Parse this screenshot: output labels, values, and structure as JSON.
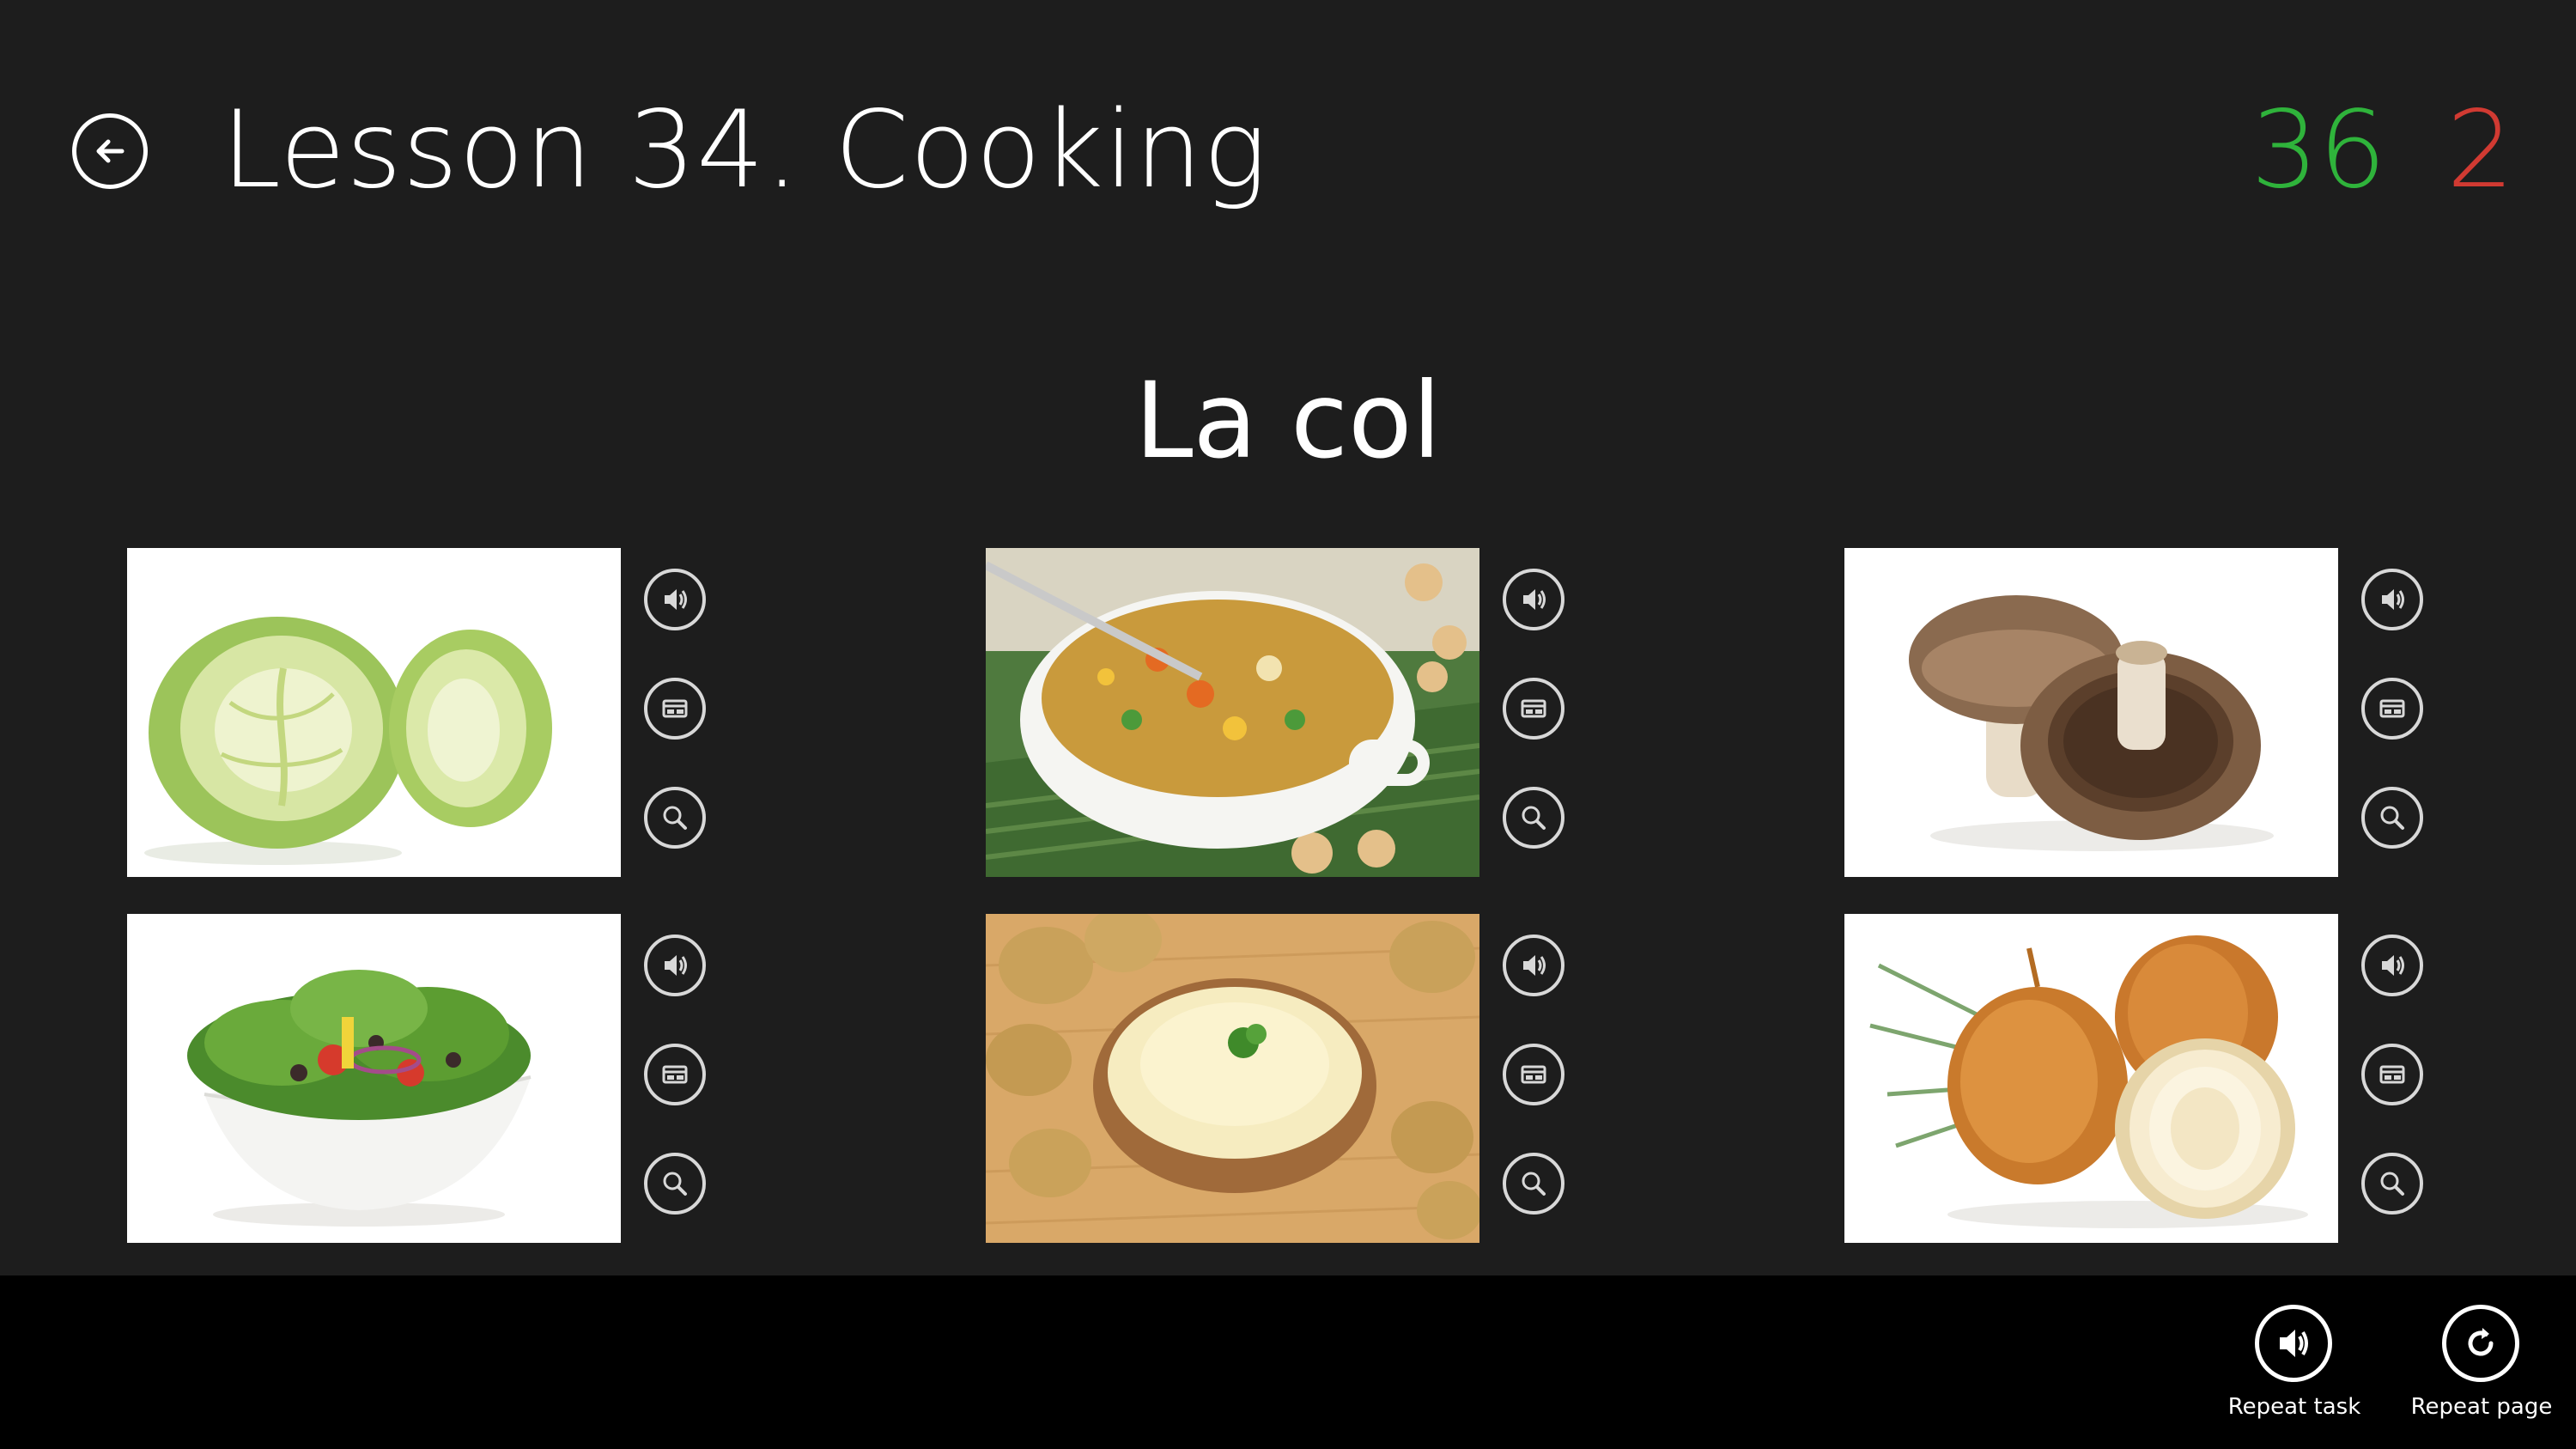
{
  "header": {
    "title": "Lesson 34. Cooking",
    "back_icon": "back-arrow-icon",
    "score_correct": "36",
    "score_wrong": "2"
  },
  "prompt": {
    "word": "La col"
  },
  "cards": [
    {
      "subject": "cabbage",
      "tools": [
        "speaker-icon",
        "card-icon",
        "magnifier-icon"
      ]
    },
    {
      "subject": "vegetable-soup",
      "tools": [
        "speaker-icon",
        "card-icon",
        "magnifier-icon"
      ]
    },
    {
      "subject": "mushrooms",
      "tools": [
        "speaker-icon",
        "card-icon",
        "magnifier-icon"
      ]
    },
    {
      "subject": "salad",
      "tools": [
        "speaker-icon",
        "card-icon",
        "magnifier-icon"
      ]
    },
    {
      "subject": "mashed-potatoes",
      "tools": [
        "speaker-icon",
        "card-icon",
        "magnifier-icon"
      ]
    },
    {
      "subject": "onions",
      "tools": [
        "speaker-icon",
        "card-icon",
        "magnifier-icon"
      ]
    }
  ],
  "app_bar": {
    "repeat_task_label": "Repeat task",
    "repeat_page_label": "Repeat page"
  },
  "colors": {
    "background": "#1d1d1d",
    "app_bar": "#000000",
    "correct": "#2fb33b",
    "wrong": "#d13a32"
  }
}
